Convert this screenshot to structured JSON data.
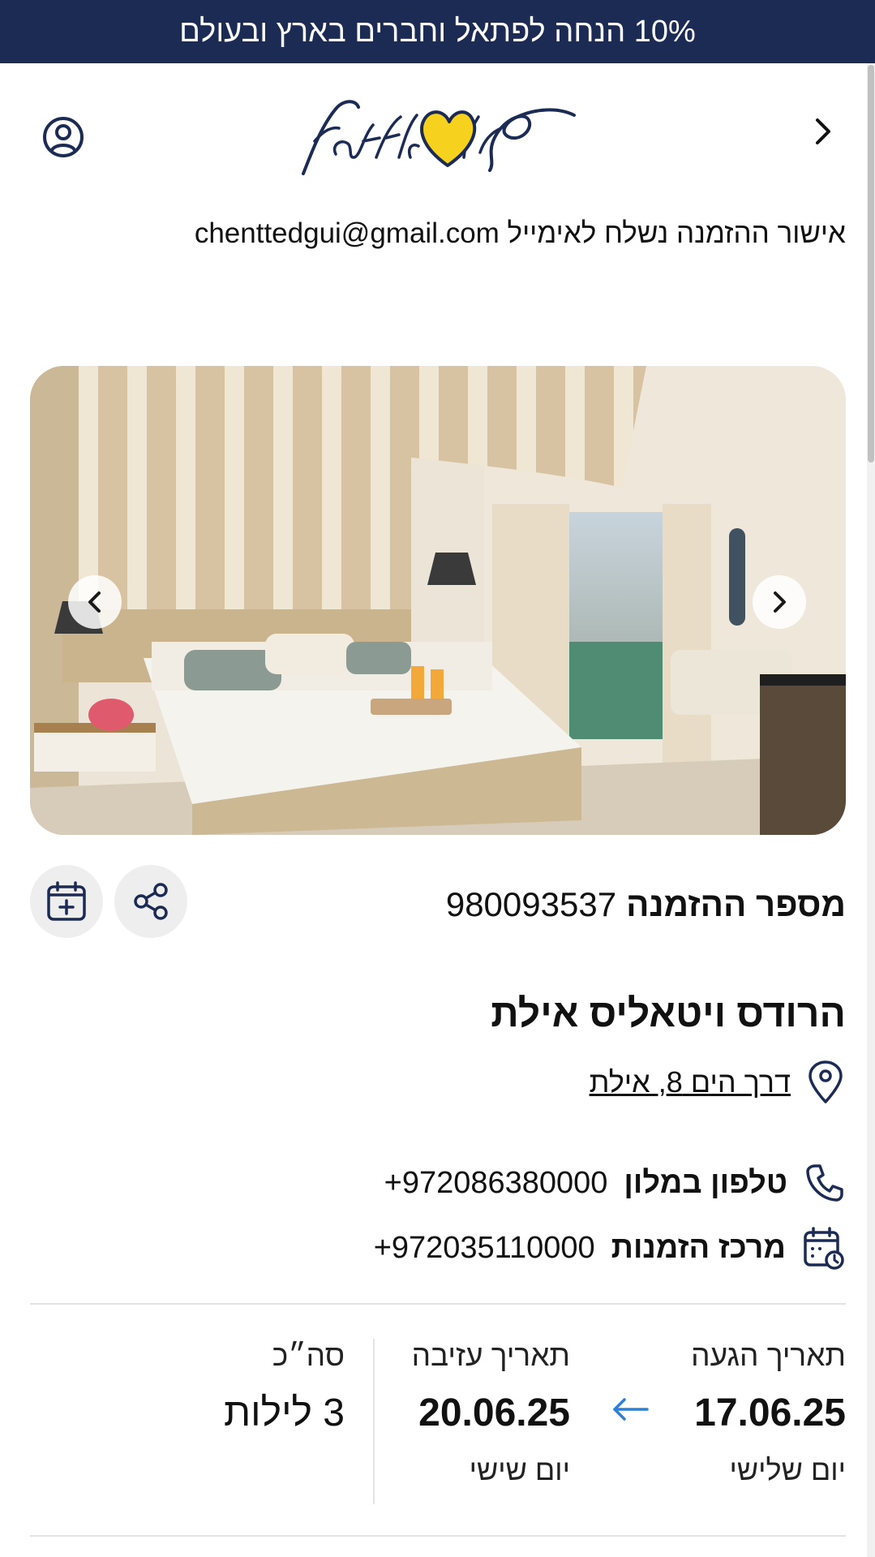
{
  "promo": {
    "text": "10% הנחה לפתאל וחברים בארץ ובעולם"
  },
  "header": {
    "logo_text_he": "פתאל",
    "logo_text_en": "fattal",
    "back_icon": "chevron-right-icon",
    "user_icon": "user-circle-icon"
  },
  "confirmation": {
    "email_line": "אישור ההזמנה נשלח לאימייל chenttedgui@gmail.com"
  },
  "booking": {
    "number_label": "מספר ההזמנה",
    "number_value": "980093537"
  },
  "hotel": {
    "name": "הרודס ויטאליס אילת",
    "address": "דרך הים 8, אילת",
    "phone_label": "טלפון במלון",
    "phone_value": "+972086380000",
    "center_label": "מרכז הזמנות",
    "center_value": "+972035110000"
  },
  "dates": {
    "arrival_label": "תאריך הגעה",
    "arrival_date": "17.06.25",
    "arrival_day": "יום שלישי",
    "departure_label": "תאריך עזיבה",
    "departure_date": "20.06.25",
    "departure_day": "יום שישי",
    "total_label": "סה״כ",
    "total_value": "3 לילות"
  },
  "colors": {
    "brand_navy": "#1c2b54",
    "brand_yellow": "#f6d21f",
    "accent_blue": "#2f7fd8"
  }
}
